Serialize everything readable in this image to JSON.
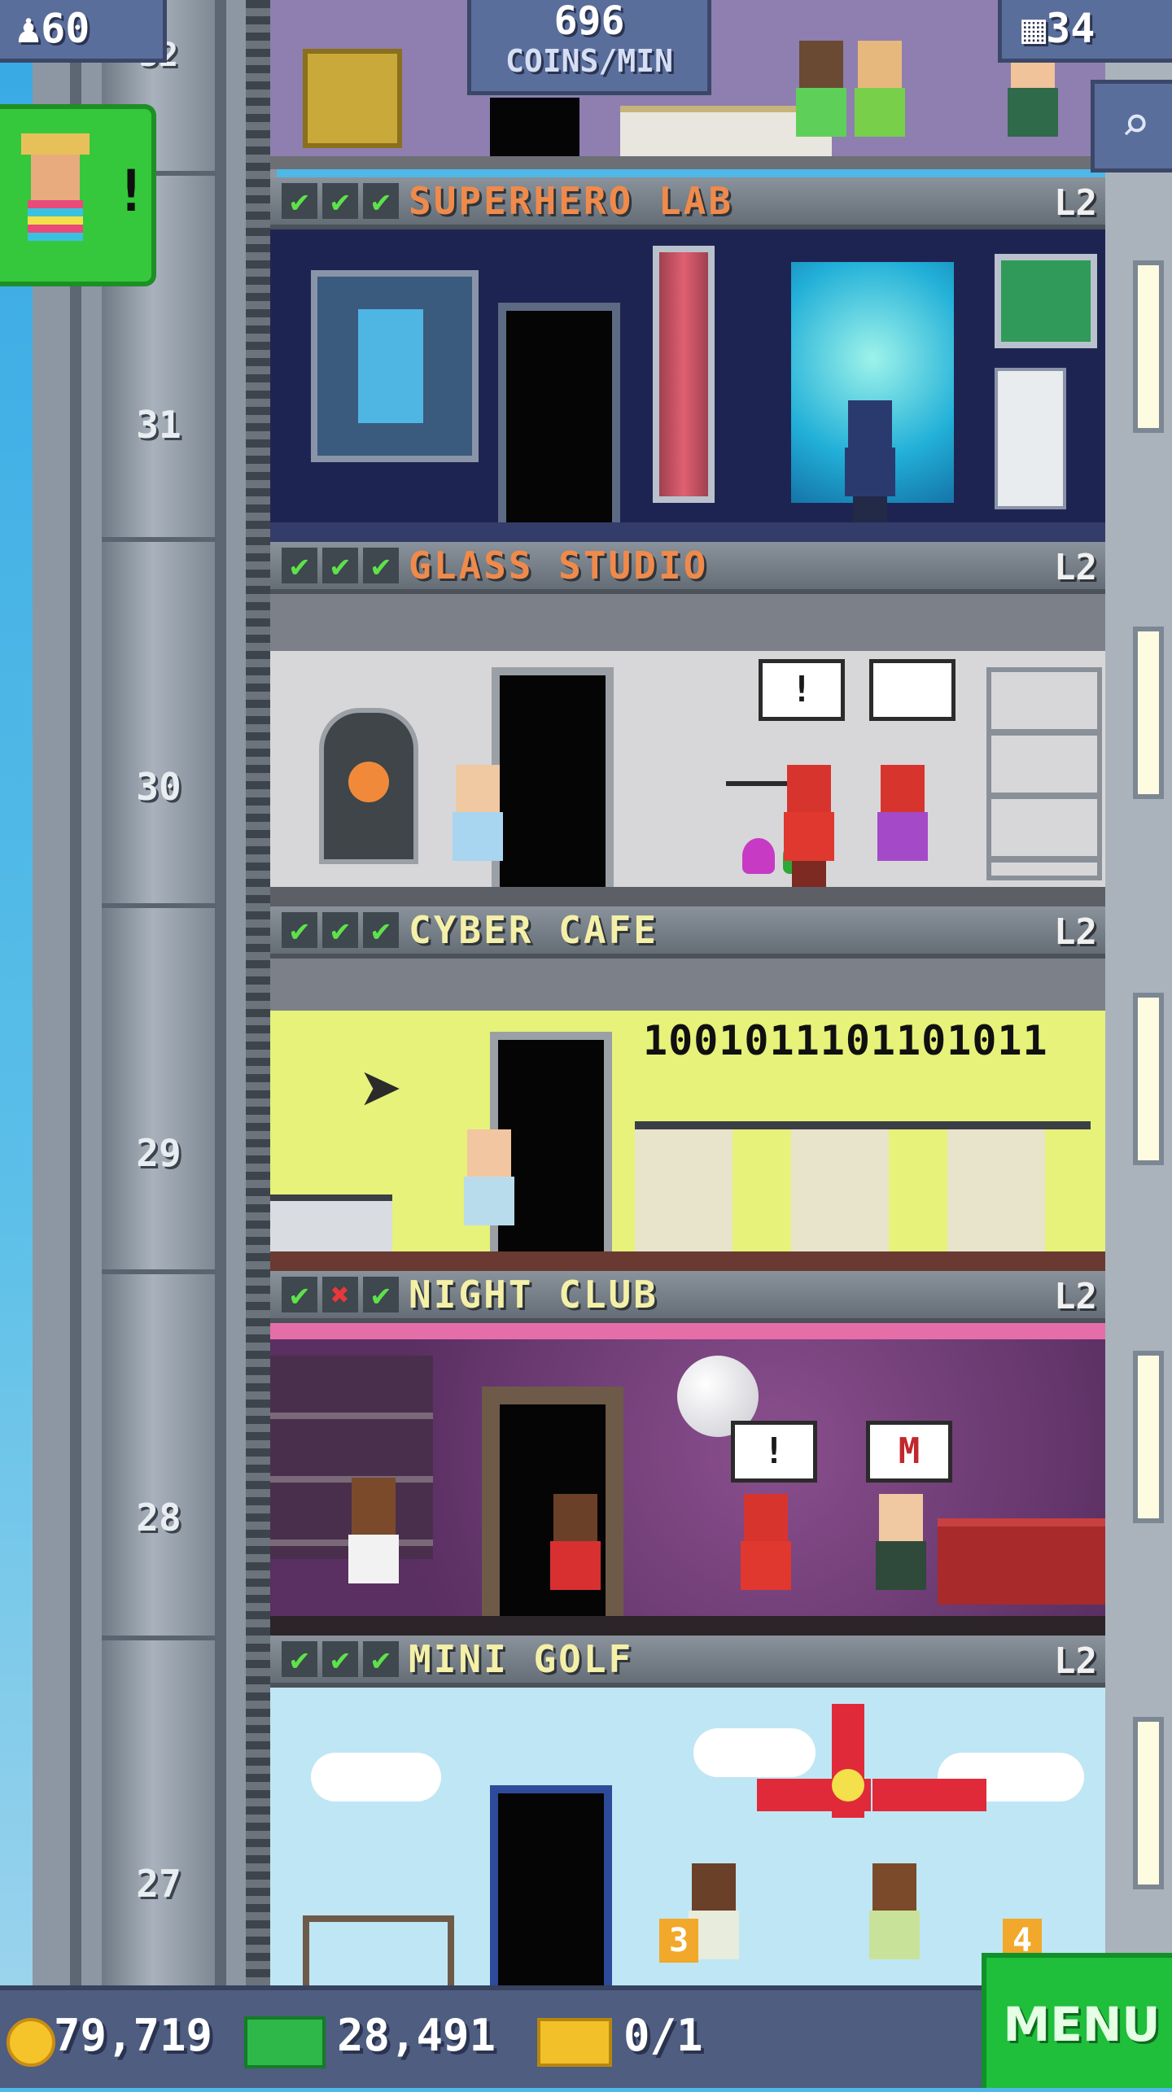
{
  "hud": {
    "population": "60",
    "coins_per_min_value": "696",
    "coins_per_min_label": "COINS/MIN",
    "floors_count": "34",
    "visitor_alert": "!"
  },
  "floors": [
    {
      "floor_number": "31",
      "name": "SUPERHERO LAB",
      "level": "L2",
      "checks": [
        "ok",
        "ok",
        "ok"
      ],
      "name_color": "#f08a4b"
    },
    {
      "floor_number": "30",
      "name": "GLASS STUDIO",
      "level": "L2",
      "checks": [
        "ok",
        "ok",
        "ok"
      ],
      "name_color": "#f08a4b",
      "bubbles": [
        "!",
        ""
      ]
    },
    {
      "floor_number": "29",
      "name": "CYBER CAFE",
      "level": "L2",
      "checks": [
        "ok",
        "ok",
        "ok"
      ],
      "name_color": "#f4f0a8",
      "wall_text": "1001011101101011"
    },
    {
      "floor_number": "28",
      "name": "NIGHT CLUB",
      "level": "L2",
      "checks": [
        "ok",
        "bad",
        "ok"
      ],
      "name_color": "#f4f0a8",
      "bubbles": [
        "!",
        "M"
      ]
    },
    {
      "floor_number": "27",
      "name": "MINI GOLF",
      "level": "L2",
      "checks": [
        "ok",
        "ok",
        "ok"
      ],
      "name_color": "#f4f0a8",
      "hole_numbers": [
        "3",
        "4"
      ]
    }
  ],
  "top_floor_number": "32",
  "bottom_bar": {
    "coins": "79,719",
    "bux": "28,491",
    "tickets": "0/1",
    "menu_label": "MENU"
  },
  "colors": {
    "accent_green": "#1fbe3b",
    "bar_blue": "#4e5d80",
    "check_ok": "#5de24a",
    "check_bad": "#e8383a"
  },
  "icons": [
    "person-icon",
    "building-icon",
    "magnifier-icon",
    "coin-icon",
    "bux-icon",
    "ticket-icon"
  ]
}
